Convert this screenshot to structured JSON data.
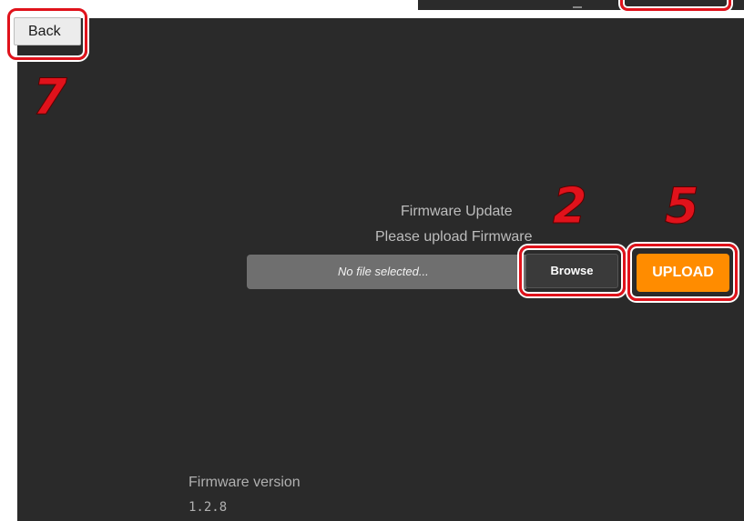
{
  "app": {
    "back_label": "Back",
    "firmware_title": "Firmware Update",
    "firmware_subtitle": "Please upload Firmware",
    "file_placeholder": "No file selected...",
    "browse_label": "Browse",
    "upload_label": "UPLOAD",
    "version_label": "Firmware version",
    "version_value": "1.2.8"
  },
  "annotations": {
    "step_back": "7",
    "step_browse": "2",
    "step_upload": "5"
  },
  "colors": {
    "panel_bg": "#2a2a2a",
    "upload_accent": "#ff8c00",
    "highlight_red": "#e0121b"
  },
  "icons": {
    "cursor": "text-cursor-icon"
  }
}
